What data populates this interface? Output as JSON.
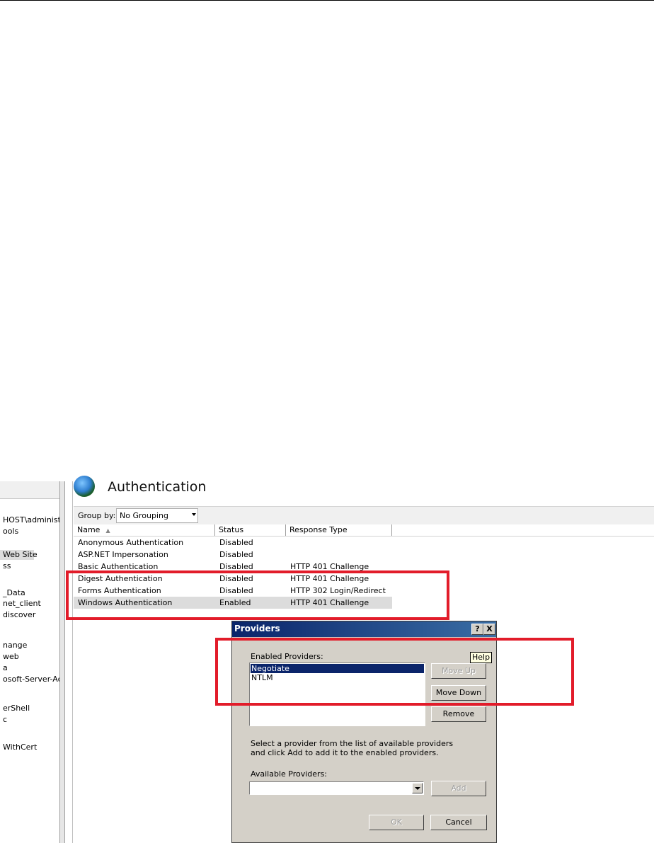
{
  "tree": {
    "items": [
      {
        "label": "HOST\\administra",
        "selected": false
      },
      {
        "label": "ools",
        "selected": false
      },
      {
        "label": "Web Site",
        "selected": true
      },
      {
        "label": "ss",
        "selected": false
      },
      {
        "label": "_Data",
        "selected": false
      },
      {
        "label": "net_client",
        "selected": false
      },
      {
        "label": "discover",
        "selected": false
      },
      {
        "label": "nange",
        "selected": false
      },
      {
        "label": "web",
        "selected": false
      },
      {
        "label": "a",
        "selected": false
      },
      {
        "label": "osoft-Server-Act",
        "selected": false
      },
      {
        "label": "erShell",
        "selected": false
      },
      {
        "label": "c",
        "selected": false
      },
      {
        "label": "WithCert",
        "selected": false
      }
    ]
  },
  "header": {
    "title": "Authentication",
    "icon": "globe-icon"
  },
  "toolbar": {
    "group_by_label": "Group by:",
    "group_by_value": "No Grouping"
  },
  "table": {
    "columns": [
      "Name",
      "Status",
      "Response Type"
    ],
    "rows": [
      {
        "name": "Anonymous Authentication",
        "status": "Disabled",
        "response": ""
      },
      {
        "name": "ASP.NET Impersonation",
        "status": "Disabled",
        "response": ""
      },
      {
        "name": "Basic Authentication",
        "status": "Disabled",
        "response": "HTTP 401 Challenge"
      },
      {
        "name": "Digest Authentication",
        "status": "Disabled",
        "response": "HTTP 401 Challenge"
      },
      {
        "name": "Forms Authentication",
        "status": "Disabled",
        "response": "HTTP 302 Login/Redirect"
      },
      {
        "name": "Windows Authentication",
        "status": "Enabled",
        "response": "HTTP 401 Challenge"
      }
    ],
    "selected_row": "Windows Authentication"
  },
  "dialog": {
    "title": "Providers",
    "help_glyph": "?",
    "close_glyph": "X",
    "enabled_label": "Enabled Providers:",
    "enabled_providers": [
      "Negotiate",
      "NTLM"
    ],
    "selected_provider": "Negotiate",
    "tooltip": "Help",
    "move_up": "Move Up",
    "move_down": "Move Down",
    "remove": "Remove",
    "instructions_line1": "Select a provider from the list of available providers",
    "instructions_line2": "and click Add to add it to the enabled providers.",
    "available_label": "Available Providers:",
    "available_value": "",
    "add": "Add",
    "ok": "OK",
    "cancel": "Cancel"
  },
  "colors": {
    "highlight_box": "#e21c2a",
    "title_bar": "#0a246a",
    "selection": "#0a246a"
  }
}
